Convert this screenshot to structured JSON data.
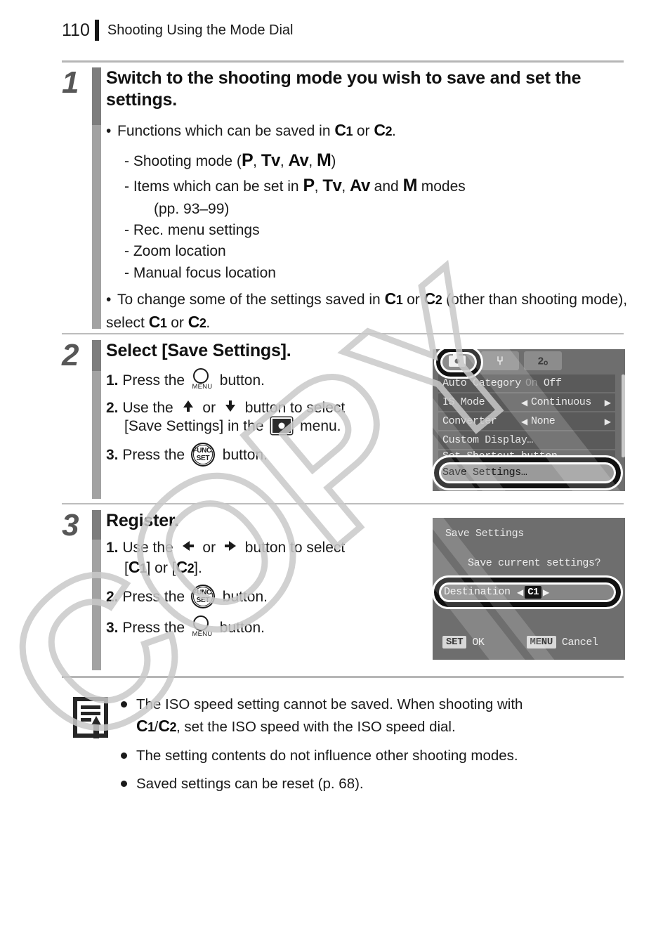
{
  "header": {
    "page_number": "110",
    "title": "Shooting Using the Mode Dial"
  },
  "steps": [
    {
      "number": "1",
      "title": "Switch to the shooting mode you wish to save and set the settings.",
      "bullet1_pre": "Functions which can be saved in",
      "bullet1_or": "or",
      "bullet1_end": ".",
      "dash1_pre": "Shooting mode (",
      "dash1_end": ")",
      "dash2_pre": "Items which can be set in",
      "dash2_and": "and",
      "dash2_end": "modes",
      "dash2_pages": "(pp. 93–99)",
      "dash3": "Rec. menu settings",
      "dash4": "Zoom location",
      "dash5": "Manual focus location",
      "bullet2_pre": "To change some of the settings saved in",
      "bullet2_or": "or",
      "bullet2_mid": "(other than shooting mode), select",
      "bullet2_or2": "or",
      "bullet2_end": "."
    },
    {
      "number": "2",
      "title": "Select [Save Settings].",
      "sub1_num": "1.",
      "sub1_pre": "Press the",
      "sub1_post": "button.",
      "sub2_num": "2.",
      "sub2_pre": "Use the",
      "sub2_or": "or",
      "sub2_post": "button to select",
      "sub2_cont_a": "[Save Settings] in the",
      "sub2_cont_b": "menu.",
      "sub3_num": "3.",
      "sub3_pre": "Press the",
      "sub3_post": "button."
    },
    {
      "number": "3",
      "title": "Register.",
      "sub1_num": "1.",
      "sub1_pre": "Use the",
      "sub1_or": "or",
      "sub1_post": "button to select",
      "sub1_cont_open": "[",
      "sub1_cont_mid": "] or [",
      "sub1_cont_close": "].",
      "sub2_num": "2.",
      "sub2_pre": "Press the",
      "sub2_post": "button.",
      "sub3_num": "3.",
      "sub3_pre": "Press the",
      "sub3_post": "button."
    }
  ],
  "mode_labels": {
    "c1_letter": "C",
    "c1_num": "1",
    "c2_letter": "C",
    "c2_num": "2",
    "p": "P",
    "tv": "Tv",
    "av": "Av",
    "m": "M",
    "comma": ",",
    "slash": "/"
  },
  "icons": {
    "menu_label": "MENU",
    "func_line1": "FUNC.",
    "func_line2": "SET",
    "wrench": "⑂",
    "mycam": "2ₒ",
    "arrow_up": "⬆",
    "arrow_down": "⬇",
    "arrow_left": "⬅",
    "arrow_right": "➡"
  },
  "lcd_menu": {
    "tabs": [
      "camera-tab",
      "tools-tab",
      "mycamera-tab"
    ],
    "rows": [
      {
        "key": "Auto Category",
        "value_on": "On",
        "value_off": "Off",
        "arrows": false
      },
      {
        "key": "IS Mode",
        "value": "Continuous",
        "arrows": true
      },
      {
        "key": "Converter",
        "value": "None",
        "arrows": true
      },
      {
        "key": "Custom Display…",
        "value": "",
        "arrows": false
      },
      {
        "key": "Set Shortcut button",
        "value": "",
        "arrows": false
      }
    ],
    "highlighted_row": "Save Settings…"
  },
  "lcd_dialog": {
    "title": "Save Settings",
    "question": "Save current settings?",
    "row_key": "Destination",
    "row_value": "C1",
    "caret_left": "◀",
    "caret_right": "▶",
    "set_key": "SET",
    "set_label": "OK",
    "menu_key": "MENU",
    "menu_label": "Cancel"
  },
  "notes": [
    {
      "text_a": "The ISO speed setting cannot be saved. When shooting with",
      "text_b": ", set the ISO speed with the ISO speed dial."
    },
    {
      "text_a": "The setting contents do not influence other shooting modes."
    },
    {
      "text_a": "Saved settings can be reset (p. 68)."
    }
  ],
  "watermark": {
    "text": "COPY"
  },
  "colors": {
    "step_number": "#575757",
    "step_bar_dark": "#7d7d7d",
    "step_bar_light": "#a2a2a2",
    "rule": "#b6b6b6",
    "lcd_bg": "#6e6e6e",
    "lcd_row": "#5a5a5a",
    "highlight_outline": "#111111"
  }
}
